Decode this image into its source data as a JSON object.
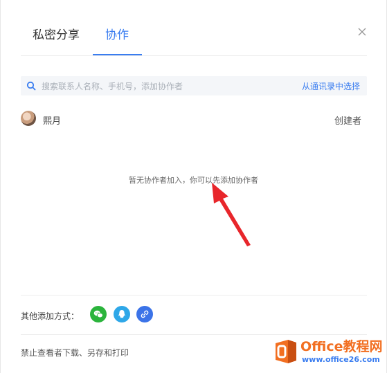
{
  "tabs": [
    {
      "label": "私密分享",
      "active": false
    },
    {
      "label": "协作",
      "active": true
    }
  ],
  "search": {
    "placeholder": "搜索联系人名称、手机号，添加协作者",
    "contacts_link": "从通讯录中选择"
  },
  "member": {
    "name": "熙月",
    "role": "创建者"
  },
  "empty_state": "暂无协作者加入，你可以先添加协作者",
  "other_methods": {
    "label": "其他添加方式：",
    "buttons": [
      "wechat-icon",
      "qq-icon",
      "link-icon"
    ]
  },
  "restrict_label": "禁止查看者下载、另存和打印",
  "watermark": {
    "title": "Office教程网",
    "url": "www.office26.com"
  },
  "colors": {
    "accent": "#3a7df0",
    "wechat": "#2bb43c",
    "qq": "#2ea7e8",
    "link": "#3b73e8",
    "annotation_arrow": "#e8262b",
    "watermark_orange": "#f26f21"
  }
}
